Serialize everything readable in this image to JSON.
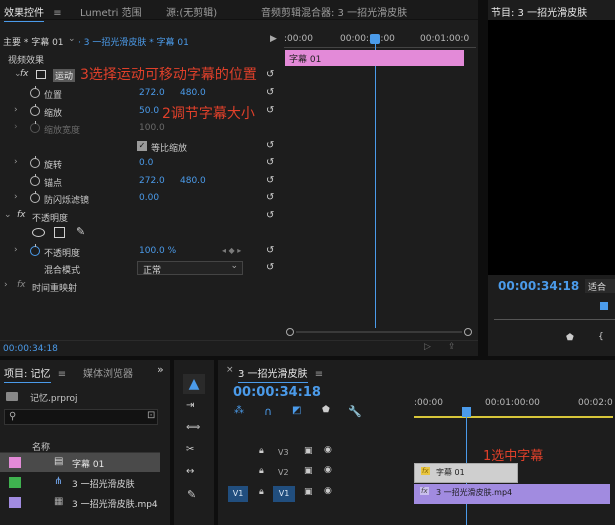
{
  "tabs": {
    "effect_controls": "效果控件",
    "lumetri": "Lumetri 范围",
    "source": "源:(无剪辑)",
    "audio_mixer": "音频剪辑混合器: 3 一招光滑皮肤",
    "program": "节目: 3 一招光滑皮肤"
  },
  "effect_header": {
    "master": "主要 * 字幕 01",
    "sequence": "3 一招光滑皮肤 * 字幕 01"
  },
  "ruler": {
    "t0": ":00:00",
    "t1": "00:00:30:00",
    "t2": "00:01:00:0"
  },
  "clip_label": "字幕 01",
  "video_effects": "视频效果",
  "motion": {
    "fx": "fx",
    "label": "运动",
    "position_label": "位置",
    "position_x": "272.0",
    "position_y": "480.0",
    "scale_label": "缩放",
    "scale_value": "50.0",
    "scale_width_label": "缩放宽度",
    "scale_width_value": "100.0",
    "uniform_scale": "等比缩放",
    "rotation_label": "旋转",
    "rotation_value": "0.0",
    "anchor_label": "锚点",
    "anchor_x": "272.0",
    "anchor_y": "480.0",
    "flicker_label": "防闪烁滤镜",
    "flicker_value": "0.00"
  },
  "opacity": {
    "fx": "fx",
    "label": "不透明度",
    "opacity_label": "不透明度",
    "opacity_value": "100.0 %",
    "blend_label": "混合模式",
    "blend_value": "正常"
  },
  "time_remap": {
    "fx": "fx",
    "label": "时间重映射"
  },
  "annotations": {
    "step3": "3选择运动可移动字幕的位置",
    "step2": "2调节字幕大小",
    "step1": "1选中字幕"
  },
  "effect_timecode": "00:00:34:18",
  "program_timecode": "00:00:34:18",
  "program_fit": "适合",
  "project": {
    "tab": "项目: 记忆",
    "media_browser": "媒体浏览器",
    "file": "记忆.prproj",
    "search_placeholder": "",
    "name_header": "名称",
    "items": [
      {
        "name": "字幕 01",
        "color": "#e38ad8"
      },
      {
        "name": "3 一招光滑皮肤",
        "color": "#3fb24f"
      },
      {
        "name": "3 一招光滑皮肤.mp4",
        "color": "#a18be0"
      }
    ]
  },
  "timeline": {
    "tab": "3 一招光滑皮肤",
    "timecode": "00:00:34:18",
    "ruler": {
      "t0": ":00:00",
      "t1": "00:01:00:00",
      "t2": "00:02:0"
    },
    "tracks": [
      {
        "name": "V3",
        "src": ""
      },
      {
        "name": "V2",
        "src": ""
      },
      {
        "name": "V1",
        "src": "V1"
      }
    ],
    "clip_title": "字幕 01",
    "clip_video": "3 一招光滑皮肤.mp4"
  },
  "colors": {
    "accent": "#4b9bea",
    "annotation": "#e0402a",
    "title_clip": "#e38ad8",
    "video_clip": "#a18be0"
  }
}
